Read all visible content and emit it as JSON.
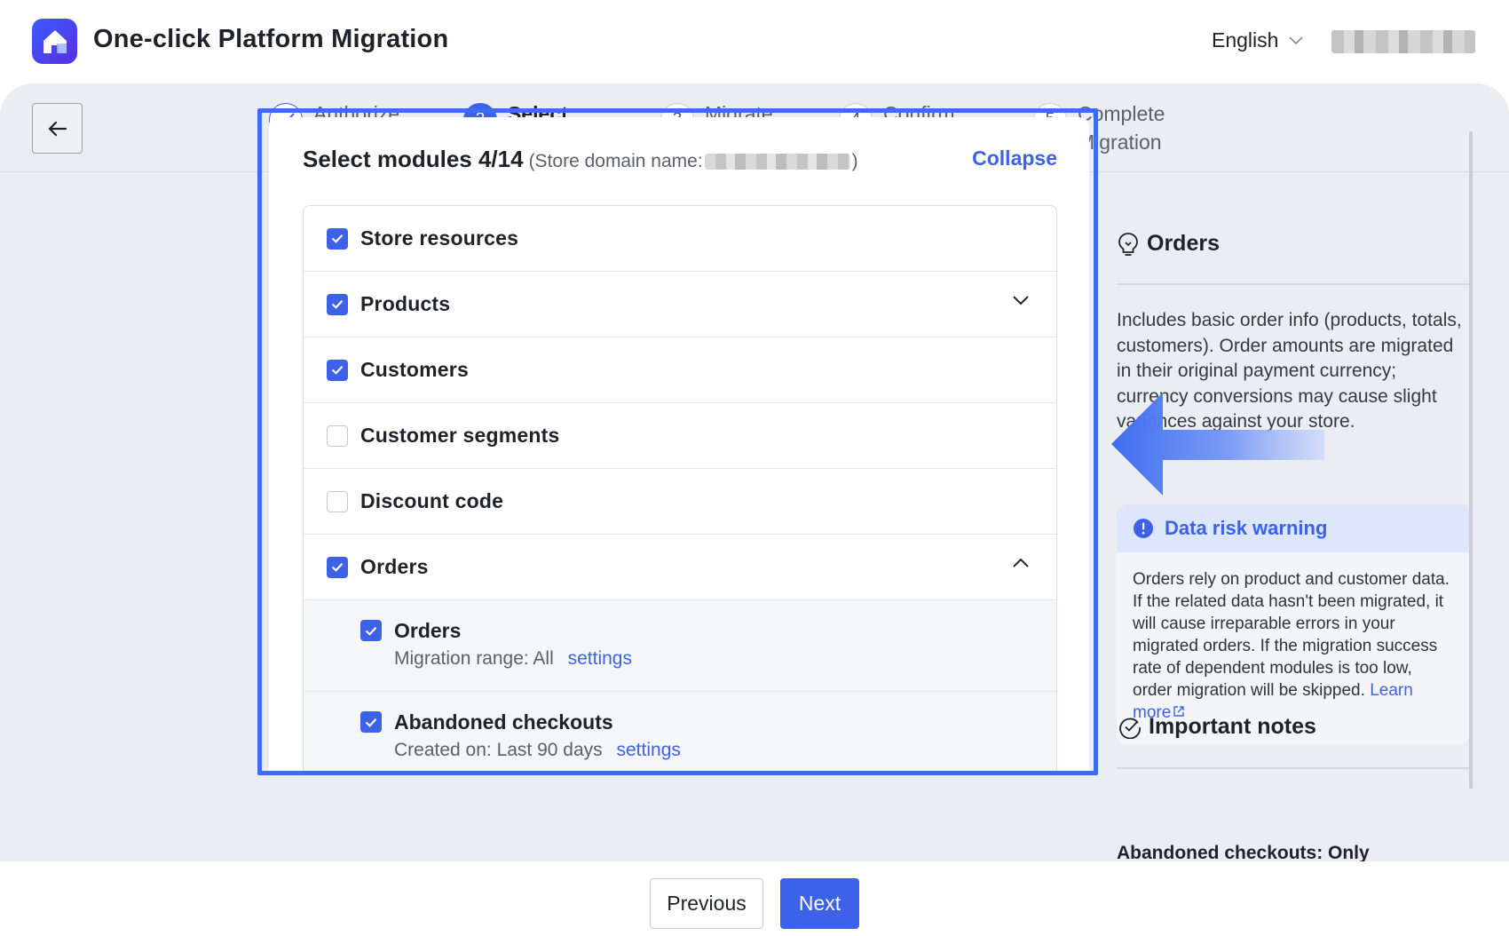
{
  "app": {
    "title": "One-click Platform Migration"
  },
  "header": {
    "language": "English"
  },
  "steps": [
    {
      "label": "Authorize store",
      "number": ""
    },
    {
      "label": "Select modules",
      "number": "2"
    },
    {
      "label": "Migrate store",
      "number": "3"
    },
    {
      "label": "Confirm results",
      "number": "4"
    },
    {
      "label": "Complete Migration",
      "number": "5"
    }
  ],
  "card": {
    "title": "Select modules 4/14",
    "domain_prefix": "(Store domain name:",
    "domain_suffix": ")",
    "collapse": "Collapse"
  },
  "modules": [
    {
      "label": "Store resources",
      "checked": true
    },
    {
      "label": "Products",
      "checked": true
    },
    {
      "label": "Customers",
      "checked": true
    },
    {
      "label": "Customer segments",
      "checked": false
    },
    {
      "label": "Discount code",
      "checked": false
    },
    {
      "label": "Orders",
      "checked": true
    }
  ],
  "suborders": [
    {
      "label": "Orders",
      "meta": "Migration range: All",
      "link": "settings",
      "checked": true
    },
    {
      "label": "Abandoned checkouts",
      "meta": "Created on: Last 90 days",
      "link": "settings",
      "checked": true
    }
  ],
  "side": {
    "title": "Orders",
    "description": "Includes basic order info (products, totals, customers). Order amounts are migrated in their original payment currency; currency conversions may cause slight variances against your store.",
    "warning_title": "Data risk warning",
    "warning_body": "Orders rely on product and customer data. If the related data hasn't been migrated, it will cause irreparable errors in your migrated orders. If the migration success rate of dependent modules is too low, order migration will be skipped.",
    "warning_link": "Learn more",
    "notes_title": "Important notes",
    "notes_first": "Abandoned checkouts: Only"
  },
  "footer": {
    "previous": "Previous",
    "next": "Next"
  },
  "colors": {
    "accent": "#3d62e8",
    "highlight_frame": "#3d6cf0"
  }
}
